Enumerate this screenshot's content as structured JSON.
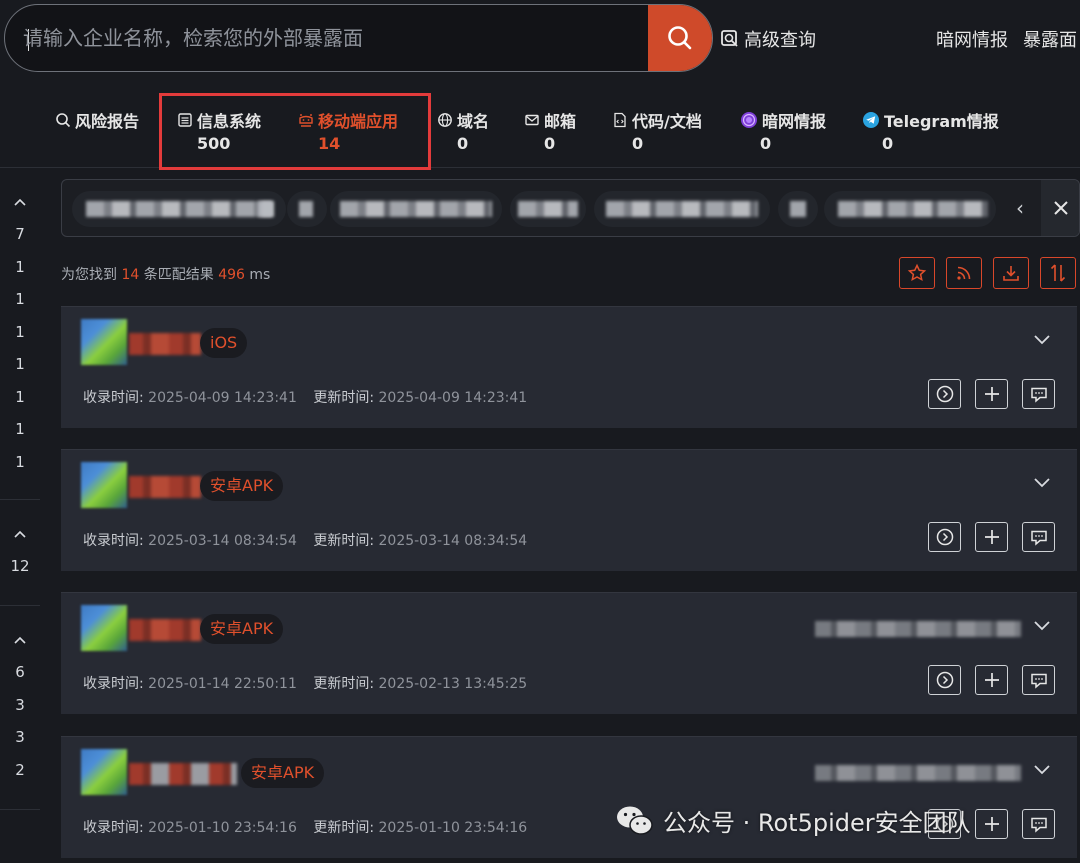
{
  "search": {
    "placeholder": "请输入企业名称，检索您的外部暴露面",
    "advanced_label": "高级查询"
  },
  "top_nav": {
    "items": [
      "暗网情报",
      "暴露面"
    ]
  },
  "tabs": [
    {
      "label": "风险报告",
      "count": "",
      "icon": "search-icon"
    },
    {
      "label": "信息系统",
      "count": "500",
      "icon": "list-icon"
    },
    {
      "label": "移动端应用",
      "count": "14",
      "icon": "mobile-app-icon",
      "active": true
    },
    {
      "label": "域名",
      "count": "0",
      "icon": "www-icon"
    },
    {
      "label": "邮箱",
      "count": "0",
      "icon": "mail-icon"
    },
    {
      "label": "代码/文档",
      "count": "0",
      "icon": "code-doc-icon"
    },
    {
      "label": "暗网情报",
      "count": "0",
      "icon": "tor-icon"
    },
    {
      "label": "Telegram情报",
      "count": "0",
      "icon": "telegram-icon"
    }
  ],
  "rail": {
    "group1": [
      "7",
      "1",
      "1",
      "1",
      "1",
      "1",
      "1",
      "1"
    ],
    "group2": [
      "12"
    ],
    "group3": [
      "6",
      "3",
      "3",
      "2"
    ]
  },
  "summary": {
    "prefix": "为您找到",
    "count": "14",
    "middle": "条匹配结果",
    "time": "496",
    "unit": "ms"
  },
  "meta_labels": {
    "collected": "收录时间:",
    "updated": "更新时间:"
  },
  "results": [
    {
      "tag": "iOS",
      "collected": "2025-04-09 14:23:41",
      "updated": "2025-04-09 14:23:41"
    },
    {
      "tag": "安卓APK",
      "collected": "2025-03-14 08:34:54",
      "updated": "2025-03-14 08:34:54"
    },
    {
      "tag": "安卓APK",
      "collected": "2025-01-14 22:50:11",
      "updated": "2025-02-13 13:45:25"
    },
    {
      "tag": "安卓APK",
      "collected": "2025-01-10 23:54:16",
      "updated": "2025-01-10 23:54:16"
    }
  ],
  "watermark": {
    "text": "公众号 · Rot5pider安全团队"
  },
  "colors": {
    "accent": "#cf4a2a",
    "highlight_box": "#e33b3b",
    "background": "#181a1f",
    "card": "#272a33"
  }
}
